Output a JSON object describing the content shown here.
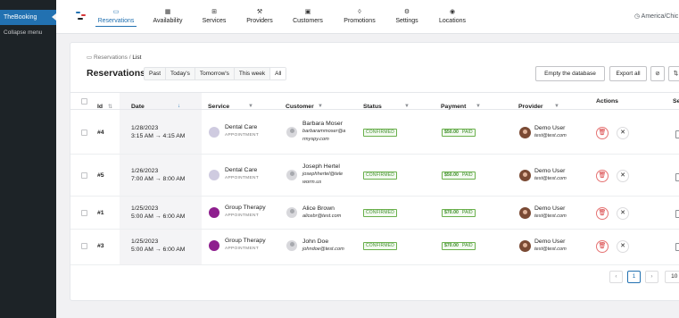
{
  "wp_sidebar": {
    "menu_item": "TheBooking",
    "collapse": "Collapse menu"
  },
  "nav": {
    "items": [
      {
        "label": "Reservations",
        "icon": "calendar-list-icon",
        "glyph": "▭",
        "active": true
      },
      {
        "label": "Availability",
        "icon": "calendar-icon",
        "glyph": "▦"
      },
      {
        "label": "Services",
        "icon": "services-icon",
        "glyph": "⊞"
      },
      {
        "label": "Providers",
        "icon": "providers-icon",
        "glyph": "⚒"
      },
      {
        "label": "Customers",
        "icon": "id-card-icon",
        "glyph": "▣"
      },
      {
        "label": "Promotions",
        "icon": "flame-icon",
        "glyph": "◊"
      },
      {
        "label": "Settings",
        "icon": "gear-icon",
        "glyph": "⚙"
      },
      {
        "label": "Locations",
        "icon": "map-pin-icon",
        "glyph": "◉"
      }
    ],
    "timezone": "America/Chic",
    "timezone_icon": "clock-icon"
  },
  "page": {
    "breadcrumb_root": "Reservations",
    "breadcrumb_sep": "/",
    "breadcrumb_current": "List",
    "title": "Reservations",
    "filters": [
      "Past",
      "Today's",
      "Tomorrow's",
      "This week",
      "All"
    ],
    "empty_db": "Empty the database",
    "export_all": "Export all"
  },
  "table": {
    "headers": {
      "id": "Id",
      "date": "Date",
      "service": "Service",
      "customer": "Customer",
      "status": "Status",
      "payment": "Payment",
      "provider": "Provider",
      "actions": "Actions",
      "extra": "Se"
    },
    "rows": [
      {
        "id": "#4",
        "date": "1/28/2023",
        "time": "3:15 AM → 4:15 AM",
        "service": "Dental Care",
        "service_sub": "APPOINTMENT",
        "service_color": "#cfcbe0",
        "customer": "Barbara Moser",
        "email1": "barbarammoser@a",
        "email2": "rmyspy.com",
        "status": "CONFIRMED",
        "amount": "$50.00",
        "paid": "PAID",
        "provider": "Demo User",
        "provider_email": "test@test.com"
      },
      {
        "id": "#5",
        "date": "1/26/2023",
        "time": "7:00 AM → 8:00 AM",
        "service": "Dental Care",
        "service_sub": "APPOINTMENT",
        "service_color": "#cfcbe0",
        "customer": "Joseph Hertel",
        "email1": "josephhertel@tele",
        "email2": "worm.us",
        "status": "CONFIRMED",
        "amount": "$50.00",
        "paid": "PAID",
        "provider": "Demo User",
        "provider_email": "test@test.com"
      },
      {
        "id": "#1",
        "date": "1/25/2023",
        "time": "5:00 AM → 6:00 AM",
        "service": "Group Therapy",
        "service_sub": "APPOINTMENT",
        "service_color": "#8e1f8e",
        "customer": "Alice Brown",
        "email1": "alicebr@test.com",
        "email2": "",
        "status": "CONFIRMED",
        "amount": "$70.00",
        "paid": "PAID",
        "provider": "Demo User",
        "provider_email": "test@test.com"
      },
      {
        "id": "#3",
        "date": "1/25/2023",
        "time": "5:00 AM → 6:00 AM",
        "service": "Group Therapy",
        "service_sub": "APPOINTMENT",
        "service_color": "#8e1f8e",
        "customer": "John Doe",
        "email1": "johndoe@test.com",
        "email2": "",
        "status": "CONFIRMED",
        "amount": "$70.00",
        "paid": "PAID",
        "provider": "Demo User",
        "provider_email": "test@test.com"
      }
    ]
  },
  "pagination": {
    "prev": "‹",
    "current": "1",
    "next": "›",
    "per_page": "10 /"
  },
  "colors": {
    "accent": "#2271b1",
    "confirmed": "#3f8f2a",
    "delete": "#d63638"
  }
}
